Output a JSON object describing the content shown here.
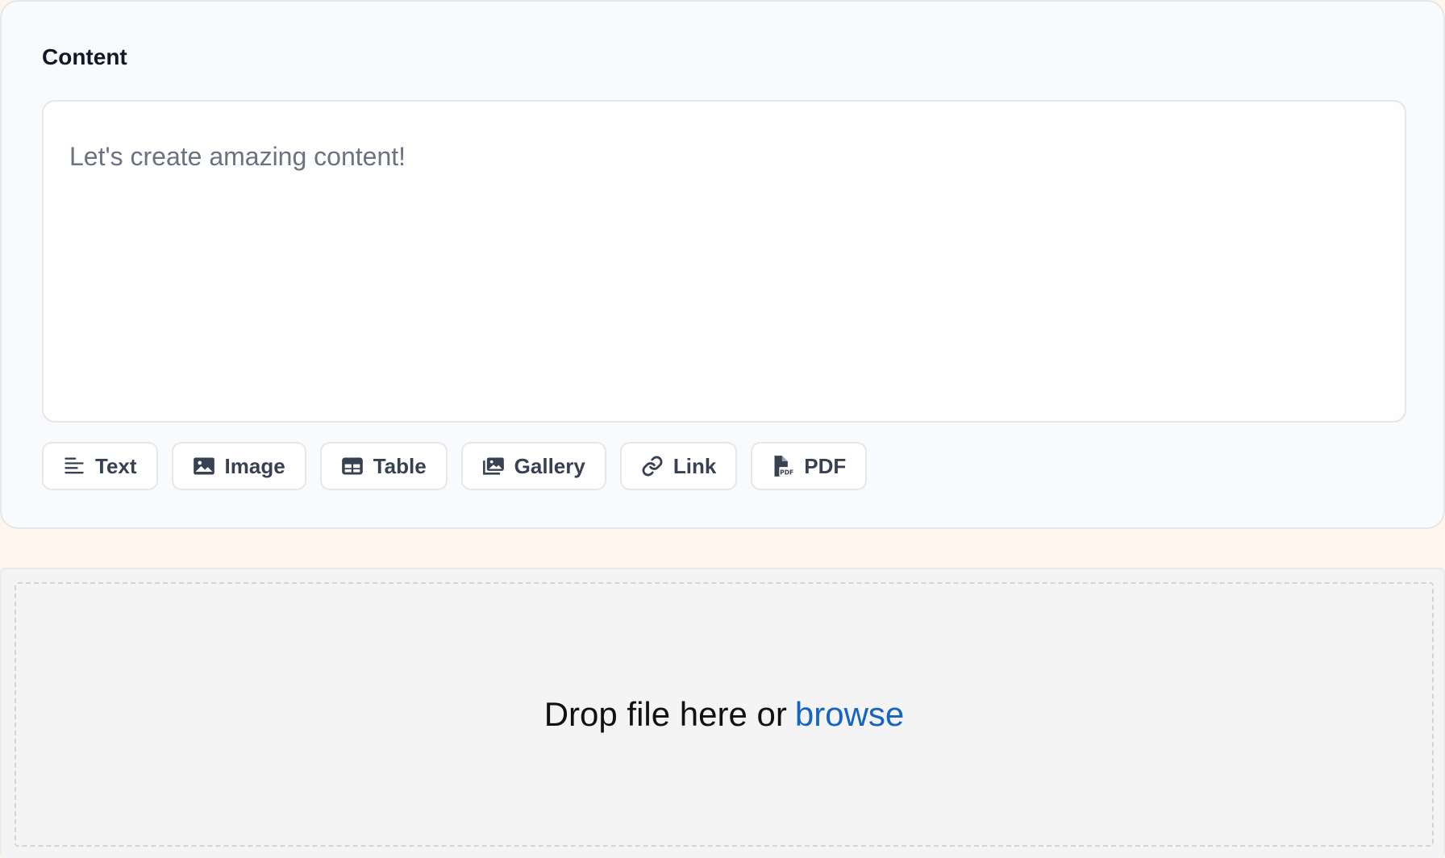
{
  "content": {
    "title": "Content",
    "editor_placeholder": "Let's create amazing content!",
    "editor_value": ""
  },
  "toolbar": {
    "buttons": [
      {
        "label": "Text",
        "icon": "text-align-icon"
      },
      {
        "label": "Image",
        "icon": "image-icon"
      },
      {
        "label": "Table",
        "icon": "table-icon"
      },
      {
        "label": "Gallery",
        "icon": "gallery-icon"
      },
      {
        "label": "Link",
        "icon": "link-icon"
      },
      {
        "label": "PDF",
        "icon": "pdf-file-icon"
      }
    ]
  },
  "dropzone": {
    "text": "Drop file here or",
    "browse_label": "browse"
  },
  "colors": {
    "page_background": "#fff7ee",
    "card_background": "#f9fafb",
    "link_blue": "#1565c0",
    "button_text": "#374151",
    "placeholder": "#6b7280"
  }
}
